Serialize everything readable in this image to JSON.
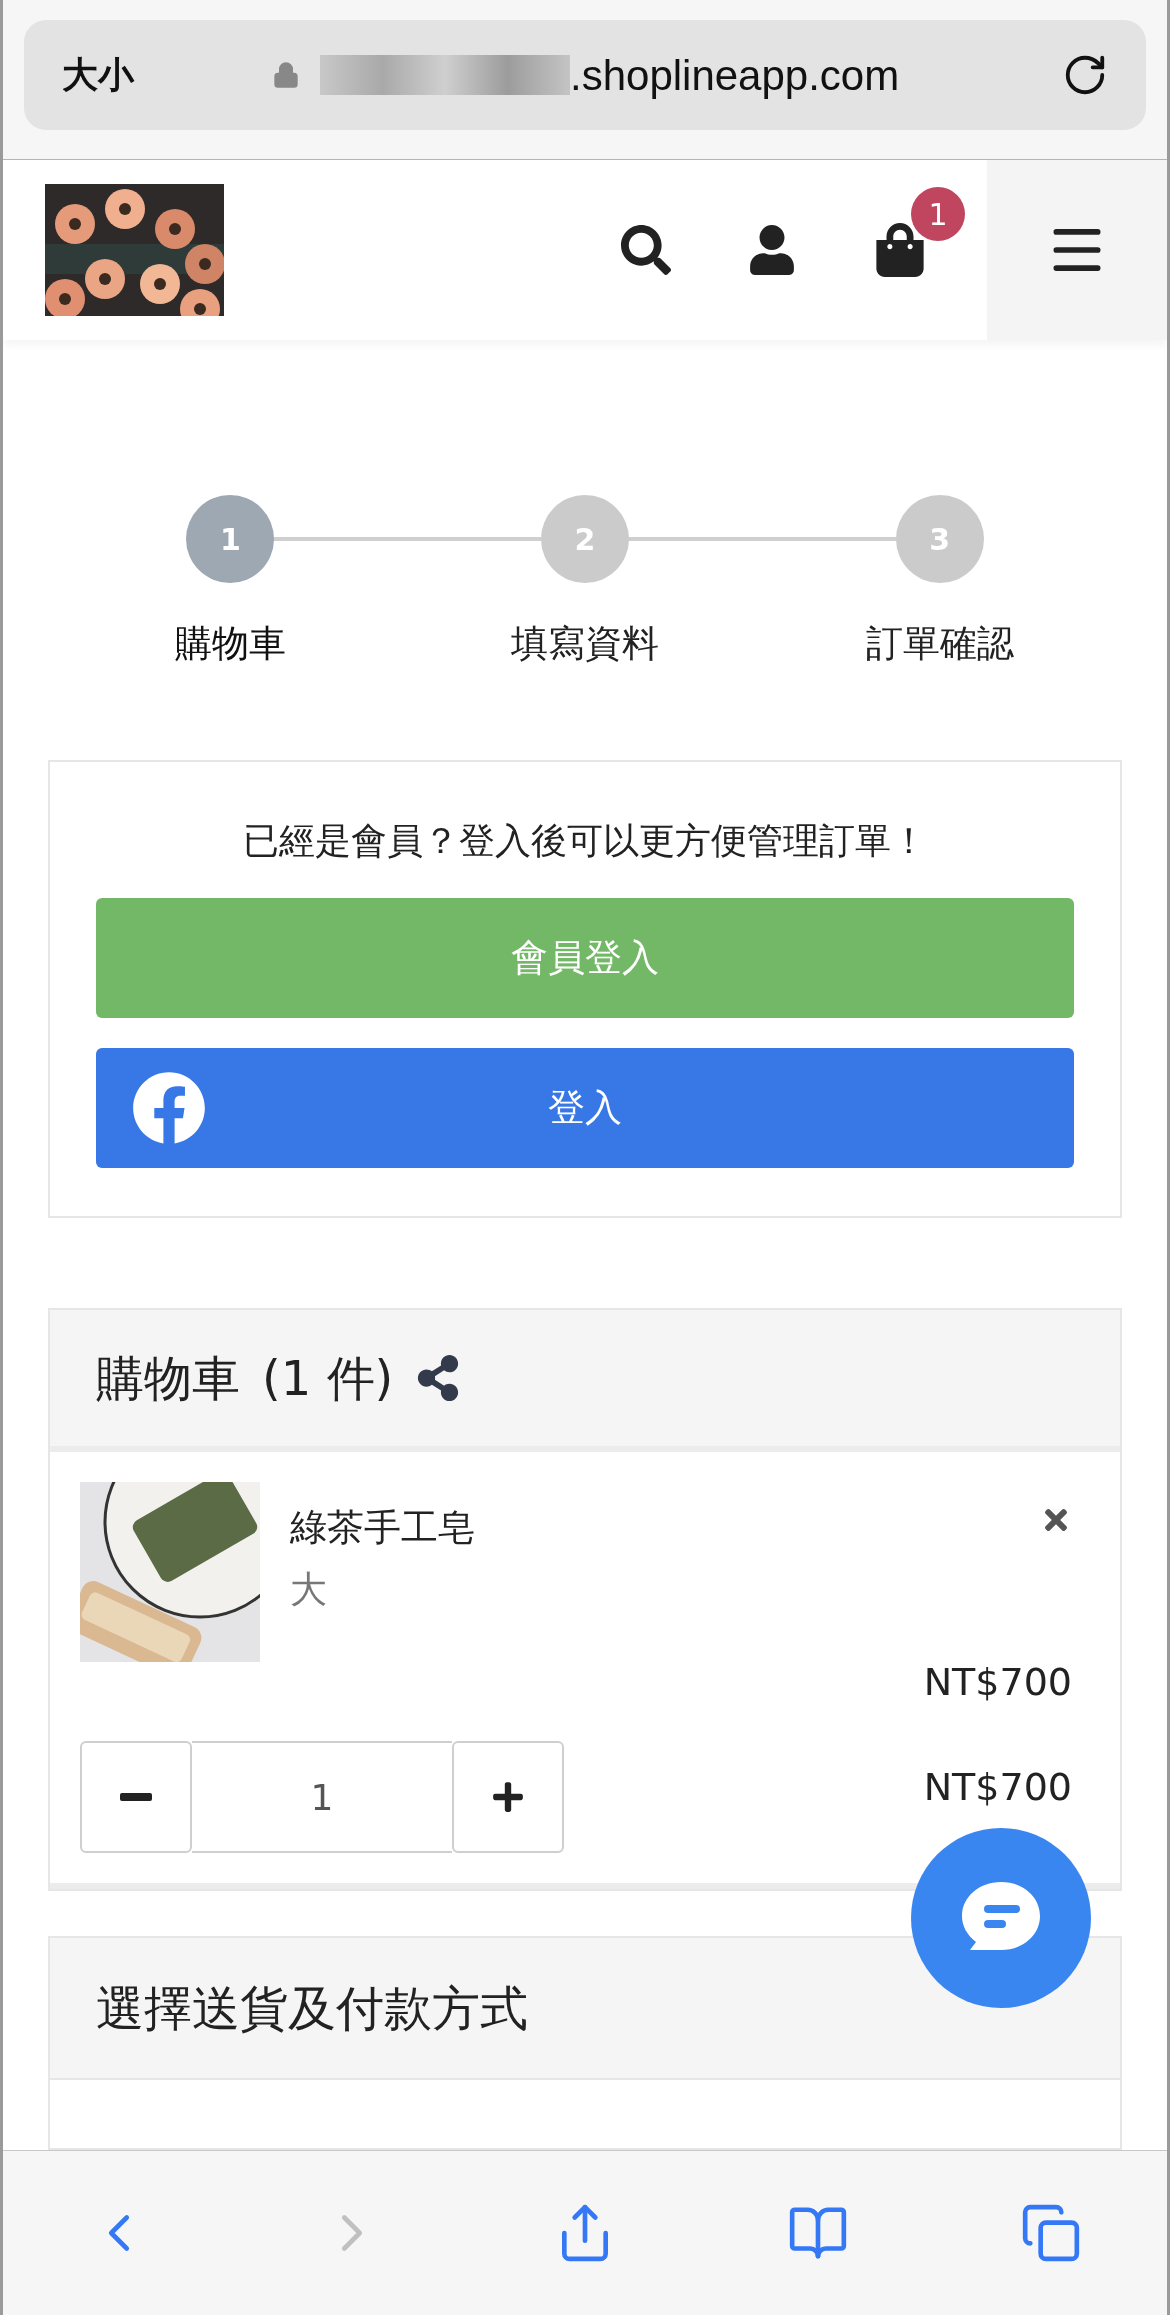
{
  "browser": {
    "text_size_button": "大小",
    "url": ".shoplineapp.com"
  },
  "header": {
    "cart_count": "1"
  },
  "steps": [
    {
      "number": "1",
      "label": "購物車",
      "selected": true
    },
    {
      "number": "2",
      "label": "填寫資料",
      "selected": false
    },
    {
      "number": "3",
      "label": "訂單確認",
      "selected": false
    }
  ],
  "login": {
    "prompt": "已經是會員？登入後可以更方便管理訂單！",
    "member_button": "會員登入",
    "facebook_button": "登入"
  },
  "cart": {
    "title": "購物車",
    "count": "(1 件)",
    "items": [
      {
        "name": "綠茶手工皂",
        "variant": "大",
        "price": "NT$700",
        "quantity": "1",
        "subtotal": "NT$700"
      }
    ]
  },
  "shipping": {
    "title": "選擇送貨及付款方式"
  },
  "toolbar": [
    {
      "kind": "back",
      "disabled": false
    },
    {
      "kind": "forward",
      "disabled": true
    },
    {
      "kind": "share",
      "disabled": false
    },
    {
      "kind": "bookmarks",
      "disabled": false
    },
    {
      "kind": "tabs",
      "disabled": false
    }
  ]
}
